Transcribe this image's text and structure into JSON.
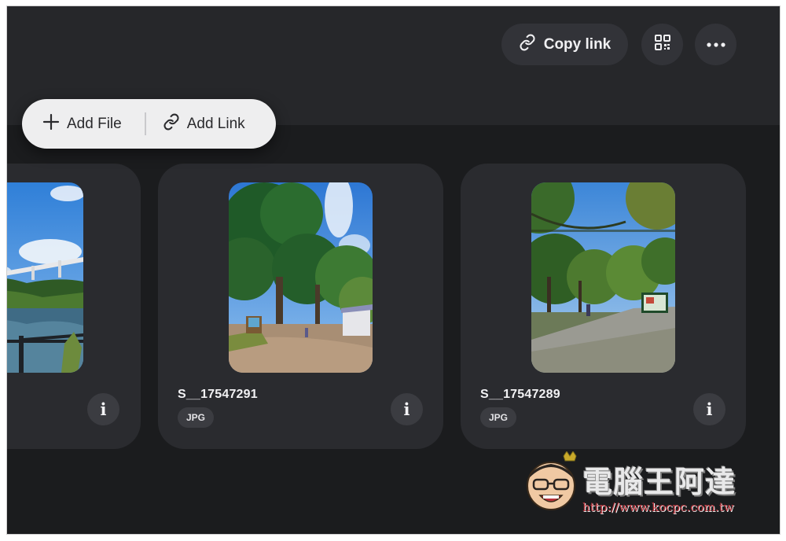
{
  "header": {
    "copy_link_label": "Copy link",
    "copy_link_icon": "link-icon",
    "qr_icon": "qr-code-icon",
    "more_icon": "ellipsis-icon"
  },
  "add_menu": {
    "add_file_label": "Add File",
    "add_file_icon": "plus-icon",
    "add_link_label": "Add Link",
    "add_link_icon": "link-icon"
  },
  "files": [
    {
      "name": "",
      "type": "",
      "info_icon": "info-icon"
    },
    {
      "name": "S__17547291",
      "type": "JPG",
      "info_icon": "info-icon"
    },
    {
      "name": "S__17547289",
      "type": "JPG",
      "info_icon": "info-icon"
    }
  ],
  "watermark": {
    "title": "電腦王阿達",
    "url": "http://www.kocpc.com.tw"
  },
  "colors": {
    "background": "#1b1c1e",
    "topbar": "#26272a",
    "card": "#2a2b2f",
    "button": "#323338",
    "add_pill": "#eeeeef"
  }
}
